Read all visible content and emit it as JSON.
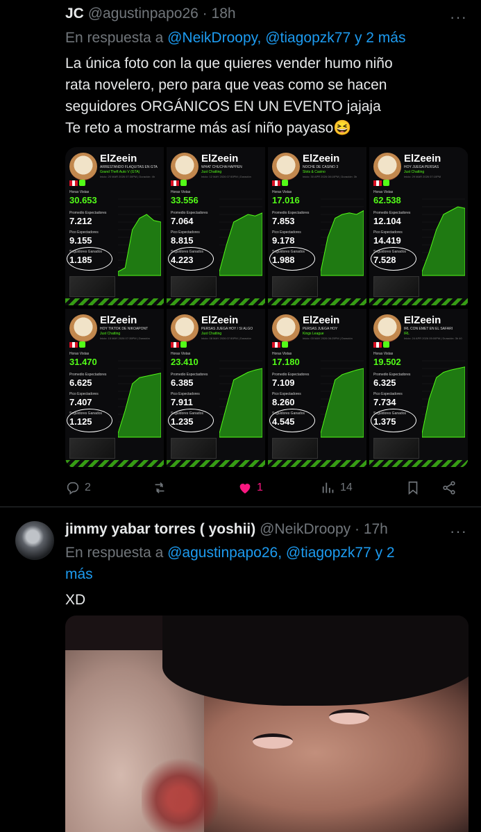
{
  "tweet1": {
    "name": "JC",
    "handle": "@agustinpapo26",
    "time": "18h",
    "more": "···",
    "reply_prefix": "En respuesta a ",
    "reply_links": "@NeikDroopy, @tiagopzk77 y 2 más",
    "text_lines": [
      "La única foto con la que quieres vender humo niño",
      "rata novelero, pero para que veas como se hacen",
      "seguidores ORGÁNICOS EN UN EVENTO jajaja",
      "Te reto a mostrarme más así niño payaso😆"
    ],
    "cards": [
      {
        "name": "ElZeein",
        "title": "ARRESTANDO FLAQUITAS EN GTA",
        "category": "Grand Theft Auto V (GTA)",
        "date": "Inicio: 20 MAR 2026 07:30PM | Duración: 4h",
        "views": "30.653",
        "avg": "7.212",
        "peak": "9.155",
        "followers": "1.185",
        "chart": [
          0.05,
          0.1,
          0.6,
          0.75,
          0.8,
          0.72,
          0.7
        ]
      },
      {
        "name": "ElZeein",
        "title": "WHAT CHUCHA HAPPEN",
        "category": "Just Chatting",
        "date": "Inicio: 12 MAY 2026 07:50PM | Duración",
        "views": "33.556",
        "avg": "7.064",
        "peak": "8.815",
        "followers": "4.223",
        "chart": [
          0.05,
          0.4,
          0.7,
          0.75,
          0.8,
          0.78,
          0.82
        ]
      },
      {
        "name": "ElZeein",
        "title": "NOCHE DE CASINO 3",
        "category": "Slots & Casino",
        "date": "Inicio: 30 APR 2026 08:10PM | Duración: 3h",
        "views": "17.016",
        "avg": "7.853",
        "peak": "9.178",
        "followers": "1.988",
        "chart": [
          0.05,
          0.5,
          0.75,
          0.8,
          0.82,
          0.8,
          0.85
        ]
      },
      {
        "name": "ElZeein",
        "title": "HOY JUEGA PERSAS",
        "category": "Just Chatting",
        "date": "Inicio: 29 MAR 2026 07:10PM",
        "views": "62.538",
        "avg": "12.104",
        "peak": "14.419",
        "followers": "7.528",
        "chart": [
          0.05,
          0.3,
          0.6,
          0.8,
          0.85,
          0.9,
          0.88
        ]
      },
      {
        "name": "ElZeein",
        "title": "HOY TIKTOK DE NIKOAPONT",
        "category": "Just Chatting",
        "date": "Inicio: 15 MAY 2026 07:35PM | Duración",
        "views": "31.470",
        "avg": "6.625",
        "peak": "7.407",
        "followers": "1.125",
        "chart": [
          0.05,
          0.35,
          0.7,
          0.78,
          0.8,
          0.82,
          0.84
        ]
      },
      {
        "name": "ElZeein",
        "title": "PERSAS JUEGA HOY / SI ALGO",
        "category": "Just Chatting",
        "date": "Inicio: 08 MAY 2026 07:50PM | Duración",
        "views": "23.410",
        "avg": "6.385",
        "peak": "7.911",
        "followers": "1.235",
        "chart": [
          0.05,
          0.4,
          0.75,
          0.8,
          0.85,
          0.88,
          0.9
        ]
      },
      {
        "name": "ElZeein",
        "title": "PERSAS JUEGA HOY",
        "category": "Kings League",
        "date": "Inicio: 03 MAY 2026 06:25PM | Duración",
        "views": "17.180",
        "avg": "7.109",
        "peak": "8.260",
        "followers": "4.545",
        "chart": [
          0.05,
          0.4,
          0.75,
          0.82,
          0.85,
          0.88,
          0.9
        ]
      },
      {
        "name": "ElZeein",
        "title": "IRL CON EMET EN EL SAFARI",
        "category": "IRL",
        "date": "Inicio: 24 APR 2026 05:00PM | Duración: 3h 40",
        "views": "19.502",
        "avg": "6.325",
        "peak": "7.734",
        "followers": "1.375",
        "chart": [
          0.05,
          0.5,
          0.78,
          0.85,
          0.88,
          0.9,
          0.92
        ]
      }
    ],
    "card_labels": {
      "views": "Horas Vistas",
      "avg": "Promedio Espectadores",
      "peak": "Pico Espectadores",
      "followers": "Seguidores Ganados"
    },
    "actions": {
      "replies": "2",
      "retweets": "",
      "likes": "1",
      "views": "14"
    }
  },
  "tweet2": {
    "name": "jimmy yabar torres ( yoshii)",
    "handle": "@NeikDroopy",
    "time": "17h",
    "more": "···",
    "reply_prefix": "En respuesta a ",
    "reply_links_line1": "@agustinpapo26, @tiagopzk77 y 2",
    "reply_links_line2": "más",
    "text": "XD"
  },
  "colors": {
    "accent": "#1d9bf0",
    "like": "#f91880",
    "muted": "#71767b",
    "kick_green": "#53fc18"
  }
}
